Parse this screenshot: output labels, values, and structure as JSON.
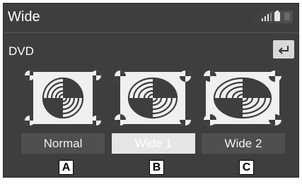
{
  "header": {
    "title": "Wide"
  },
  "status_icons": [
    "signal-icon",
    "battery-icon",
    "status-icon"
  ],
  "source": {
    "label": "DVD"
  },
  "back_button": {
    "icon": "back-arrow-icon"
  },
  "modes": [
    {
      "label": "Normal",
      "selected": false
    },
    {
      "label": "Wide 1",
      "selected": true
    },
    {
      "label": "Wide 2",
      "selected": false
    }
  ],
  "callouts": [
    "A",
    "B",
    "C"
  ],
  "colors": {
    "background": "#3e3e3e",
    "button": "#4f4f4f",
    "selected_button": "#e6e6e6",
    "text": "#ffffff"
  }
}
